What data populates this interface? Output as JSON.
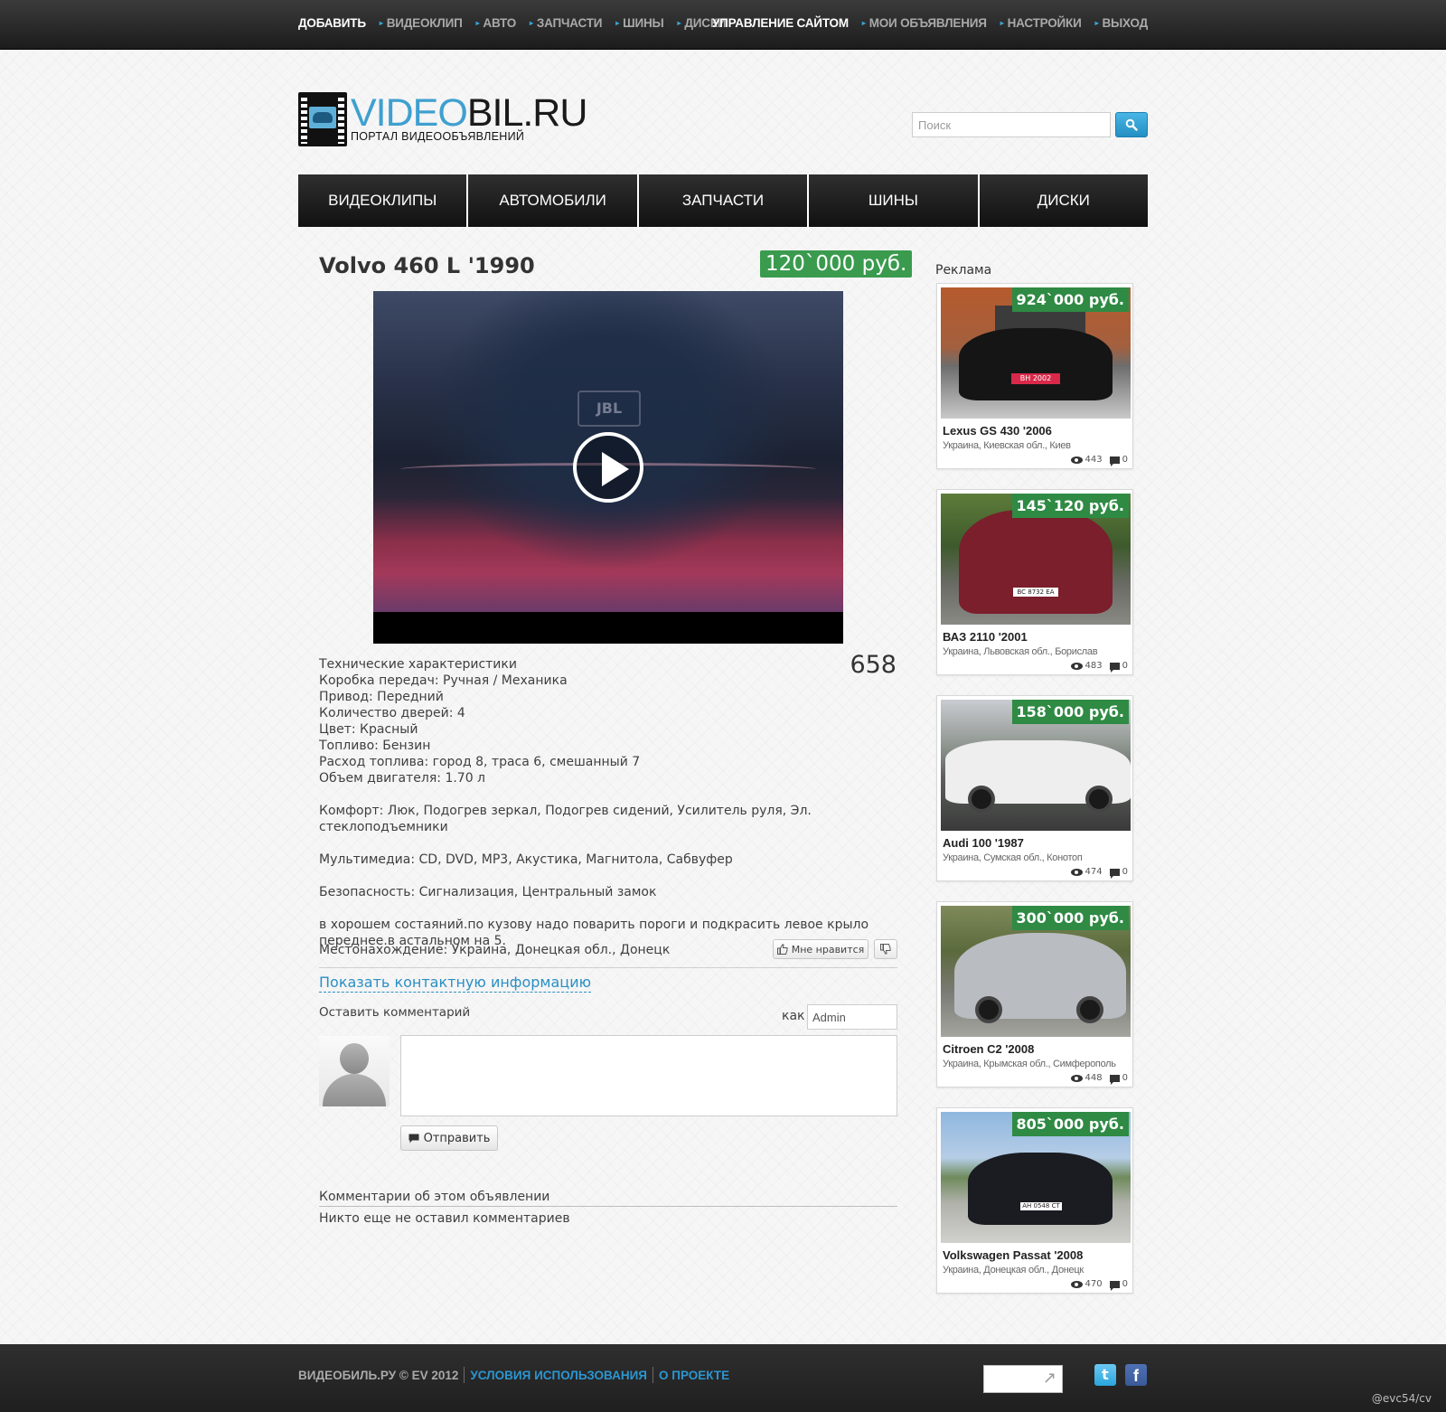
{
  "topbar": {
    "left": [
      "ДОБАВИТЬ",
      "ВИДЕОКЛИП",
      "АВТО",
      "ЗАПЧАСТИ",
      "ШИНЫ",
      "ДИСКИ"
    ],
    "right": [
      "УПРАВЛЕНИЕ САЙТОМ",
      "МОИ ОБЪЯВЛЕНИЯ",
      "НАСТРОЙКИ",
      "ВЫХОД"
    ]
  },
  "logo": {
    "part1": "VIDEO",
    "part2": "BIL.RU",
    "subtitle": "ПОРТАЛ ВИДЕООБЪЯВЛЕНИЙ"
  },
  "search": {
    "placeholder": "Поиск",
    "icon": "search-icon"
  },
  "menu": [
    "ВИДЕОКЛИПЫ",
    "АВТОМОБИЛИ",
    "ЗАПЧАСТИ",
    "ШИНЫ",
    "ДИСКИ"
  ],
  "listing": {
    "title": "Volvo 460 L '1990",
    "price": "120`000 руб.",
    "views": "658",
    "video_badge": "JBL",
    "specs": [
      "Технические характеристики",
      "Коробка передач: Ручная / Механика",
      "Привод: Передний",
      "Количество дверей: 4",
      "Цвет: Красный",
      "Топливо: Бензин",
      "Расход топлива: город 8, траса 6, смешанный 7",
      "Объем двигателя: 1.70 л",
      "",
      "Комфорт: Люк, Подогрев зеркал, Подогрев сидений, Усилитель руля, Эл. стеклоподъемники",
      "",
      "Мультимедиа: CD, DVD, MP3, Акустика, Магнитола, Сабвуфер",
      "",
      "Безопасность: Сигнализация, Центральный замок",
      "",
      "в хорошем состаяний.по кузову надо поварить пороги и подкрасить левое крыло",
      "переднее.в астальном на 5."
    ],
    "location": "Местонахождение: Украина, Донецкая обл., Донецк",
    "like_label": "Мне нравится",
    "contact_link": "Показать контактную информацию"
  },
  "comment_form": {
    "label": "Оставить комментарий",
    "as_label": "как",
    "as_value": "Admin",
    "send_label": "Отправить"
  },
  "comments": {
    "title": "Комментарии об этом объявлении",
    "empty": "Никто еще не оставил комментариев"
  },
  "ads": {
    "title": "Реклама",
    "items": [
      {
        "price": "924`000 руб.",
        "name": "Lexus GS 430 '2006",
        "location": "Украина, Киевская обл., Киев",
        "views": "443",
        "comments": "0",
        "plate": "BH 2002",
        "color": "#141414"
      },
      {
        "price": "145`120 руб.",
        "name": "ВАЗ 2110 '2001",
        "location": "Украина, Львовская обл., Борислав",
        "views": "483",
        "comments": "0",
        "plate": "BC 8732 EA",
        "color": "#7a1f2b"
      },
      {
        "price": "158`000 руб.",
        "name": "Audi 100 '1987",
        "location": "Украина, Сумская обл., Конотоп",
        "views": "474",
        "comments": "0",
        "plate": "",
        "color": "#eeeeee"
      },
      {
        "price": "300`000 руб.",
        "name": "Citroen C2 '2008",
        "location": "Украина, Крымская обл., Симферополь",
        "views": "448",
        "comments": "0",
        "plate": "",
        "color": "#b9bcc0"
      },
      {
        "price": "805`000 руб.",
        "name": "Volkswagen Passat '2008",
        "location": "Украина, Донецкая обл., Донецк",
        "views": "470",
        "comments": "0",
        "plate": "AH 0548 CT",
        "color": "#1a1c22"
      }
    ]
  },
  "footer": {
    "copyright": "ВИДЕОБИЛЬ.РУ © EV 2012",
    "links": [
      "УСЛОВИЯ ИСПОЛЬЗОВАНИЯ",
      "О ПРОЕКТЕ"
    ],
    "twitter": "t",
    "facebook": "f"
  },
  "watermark": "@evc54/cv",
  "colors": {
    "accent": "#2b96d1",
    "price": "#3a9b4e",
    "topbar": "#2a2a2a"
  }
}
